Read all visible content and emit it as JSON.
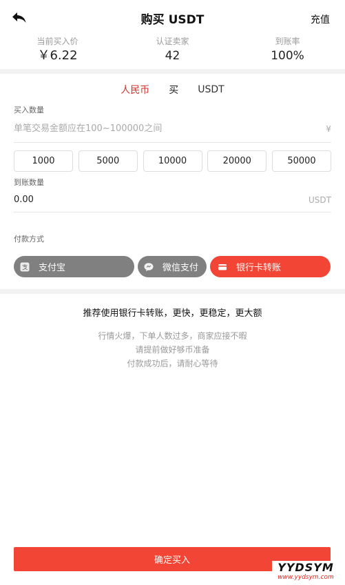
{
  "header": {
    "title": "购买 USDT",
    "recharge": "充值"
  },
  "stats": [
    {
      "label": "当前买入价",
      "value": "￥6.22"
    },
    {
      "label": "认证卖家",
      "value": "42"
    },
    {
      "label": "到账率",
      "value": "100%"
    }
  ],
  "direction": {
    "fiat": "人民币",
    "action": "买",
    "coin": "USDT"
  },
  "buy_amount": {
    "label": "买入数量",
    "placeholder": "单笔交易金额应在100~100000之间",
    "unit": "¥"
  },
  "quick_amounts": [
    "1000",
    "5000",
    "10000",
    "20000",
    "50000"
  ],
  "receive": {
    "label": "到账数量",
    "value": "0.00",
    "unit": "USDT"
  },
  "payment": {
    "label": "付款方式",
    "methods": [
      {
        "label": "支付宝",
        "icon": "alipay-icon",
        "color": "#808080"
      },
      {
        "label": "微信支付",
        "icon": "wechat-icon",
        "color": "#808080"
      },
      {
        "label": "银行卡转账",
        "icon": "bank-card-icon",
        "color": "#f24535"
      }
    ]
  },
  "recommend": "推荐使用银行卡转账，更快，更稳定，更大额",
  "notes": [
    "行情火爆，下单人数过多，商家应接不暇",
    "请提前做好够币准备",
    "付款成功后，请耐心等待"
  ],
  "confirm_label": "确定买入",
  "watermark": {
    "main": "YYDSYM",
    "sub": "www.yydsym.com"
  },
  "colors": {
    "accent": "#f24535",
    "inactive": "#808080",
    "fiat_text": "#d0332b"
  }
}
